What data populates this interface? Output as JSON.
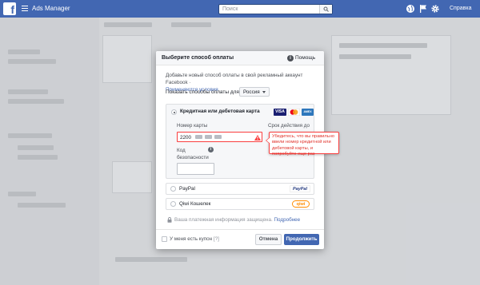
{
  "topbar": {
    "app_title": "Ads Manager",
    "search_placeholder": "Поиск",
    "help": "Справка"
  },
  "dialog": {
    "title": "Выберите способ оплаты",
    "help": "Помощь",
    "intro": "Добавьте новый способ оплаты в свой рекламный аккаунт Facebook ·",
    "terms_link": "Применяются условия",
    "show_label": "Показать способы оплаты для:",
    "country": "Россия",
    "card_option": {
      "label": "Кредитная или дебетовая карта",
      "brands": [
        "VISA",
        "MasterCard",
        "AMEX"
      ],
      "card_number_label": "Номер карты",
      "card_number_value": "2200",
      "expiry_label": "Срок действия до",
      "cvv_label_1": "Код",
      "cvv_label_2": "безопасности"
    },
    "error_tooltip": "Убедитесь, что вы правильно ввели номер кредитной или дебетовой карты, и попробуйте еще раз",
    "paypal": {
      "label": "PayPal",
      "logo": "PayPal"
    },
    "qiwi": {
      "label": "Qiwi Кошелек",
      "logo": "qiwi"
    },
    "secure_text": "Ваша платежная информация защищена.",
    "secure_more": "Подробнее",
    "coupon_label": "У меня есть купон",
    "coupon_hint": "[?]",
    "cancel": "Отмена",
    "continue": "Продолжить"
  },
  "colors": {
    "brand_blue": "#4267b2",
    "error_red": "#fa3e3e"
  }
}
